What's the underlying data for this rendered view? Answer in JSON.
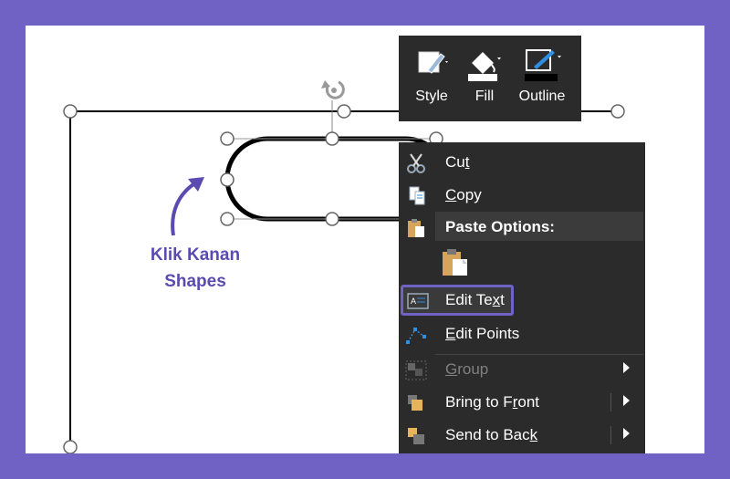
{
  "mini_toolbar": {
    "buttons": [
      {
        "label": "Style",
        "icon": "style-icon"
      },
      {
        "label": "Fill",
        "icon": "fill-bucket-icon"
      },
      {
        "label": "Outline",
        "icon": "outline-pen-icon"
      }
    ]
  },
  "context_menu": {
    "cut": {
      "label_pre": "Cu",
      "label_key": "t",
      "label_post": "",
      "icon": "scissors-icon"
    },
    "copy": {
      "label_pre": "",
      "label_key": "C",
      "label_post": "opy",
      "icon": "copy-icon"
    },
    "paste_options": {
      "label": "Paste Options:",
      "icon": "paste-icon",
      "option_icon": "paste-keep-formatting-icon"
    },
    "edit_text": {
      "label_pre": "Edit Te",
      "label_key": "x",
      "label_post": "t",
      "icon": "edit-text-icon",
      "highlighted": true
    },
    "edit_points": {
      "label_pre": "",
      "label_key": "E",
      "label_post": "dit Points",
      "icon": "edit-points-icon"
    },
    "group": {
      "label_pre": "",
      "label_key": "G",
      "label_post": "roup",
      "icon": "group-icon",
      "disabled": true
    },
    "bring_to_front": {
      "label_pre": "Bring to F",
      "label_key": "r",
      "label_post": "ont",
      "icon": "bring-to-front-icon"
    },
    "send_to_back": {
      "label_pre": "Send to Bac",
      "label_key": "k",
      "label_post": "",
      "icon": "send-to-back-icon"
    }
  },
  "annotation": {
    "line1": "Klik Kanan",
    "line2": "Shapes",
    "color": "#5b4bb0"
  },
  "colors": {
    "frame": "#6f62c4",
    "menu_bg": "#2b2b2b",
    "highlight": "#6f62c4",
    "accent_blue": "#2e8fe0"
  }
}
